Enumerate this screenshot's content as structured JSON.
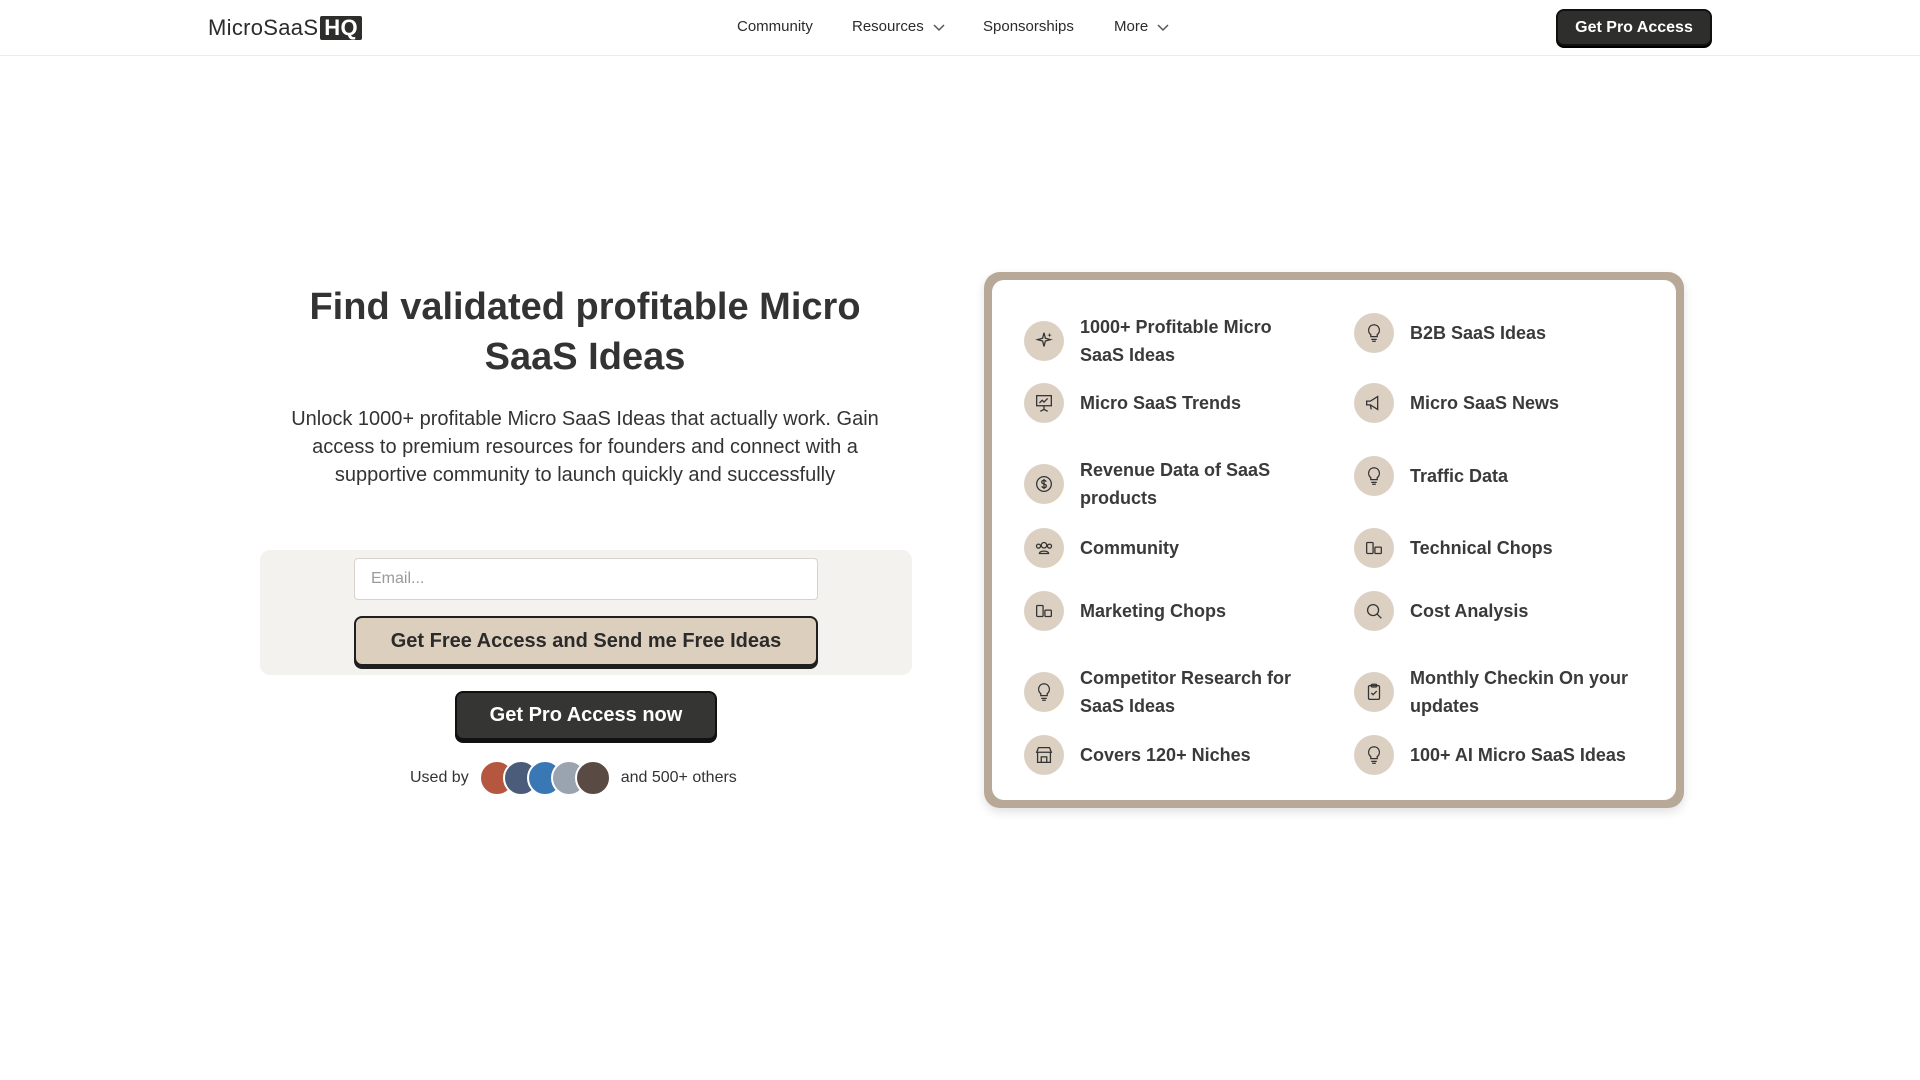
{
  "header": {
    "logo_text": "MicroSaaS",
    "logo_badge": "HQ",
    "nav": [
      {
        "label": "Community"
      },
      {
        "label": "Resources"
      },
      {
        "label": "Sponsorships"
      },
      {
        "label": "More"
      }
    ],
    "cta_label": "Get Pro Access"
  },
  "hero": {
    "title": "Find validated profitable Micro SaaS Ideas",
    "subtitle": "Unlock 1000+ profitable Micro SaaS Ideas that actually work. Gain access to premium resources for founders and connect with a supportive community to launch quickly and successfully",
    "email_placeholder": "Email...",
    "free_button": "Get Free Access and Send me Free Ideas",
    "pro_button": "Get Pro Access now",
    "used_by_prefix": "Used by",
    "used_by_suffix": "and 500+ others",
    "avatar_colors": [
      "#b5573f",
      "#4a5c7a",
      "#3a78b5",
      "#9aa4b0",
      "#5a4a44"
    ]
  },
  "features": [
    {
      "label": "1000+ Profitable Micro SaaS Ideas",
      "icon": "sparkles-icon"
    },
    {
      "label": "B2B SaaS Ideas",
      "icon": "lightbulb-icon"
    },
    {
      "label": "Micro SaaS Trends",
      "icon": "presentation-chart-icon"
    },
    {
      "label": "Micro SaaS News",
      "icon": "megaphone-icon"
    },
    {
      "label": "Revenue Data of SaaS products",
      "icon": "dollar-circle-icon"
    },
    {
      "label": "Traffic Data",
      "icon": "lightbulb-icon"
    },
    {
      "label": "Community",
      "icon": "users-icon"
    },
    {
      "label": "Technical Chops",
      "icon": "layout-icon"
    },
    {
      "label": "Marketing Chops",
      "icon": "layout-icon"
    },
    {
      "label": "Cost Analysis",
      "icon": "search-icon"
    },
    {
      "label": "Competitor Research for SaaS Ideas",
      "icon": "lightbulb-icon"
    },
    {
      "label": "Monthly Checkin On your updates",
      "icon": "clipboard-icon"
    },
    {
      "label": "Covers 120+ Niches",
      "icon": "store-icon"
    },
    {
      "label": "100+ AI Micro SaaS Ideas",
      "icon": "lightbulb-icon"
    }
  ],
  "colors": {
    "accent_dark": "#2e2e2c",
    "accent_beige": "#dccfbd",
    "card_border": "#b8a898",
    "icon_bg": "#dcd0c2"
  }
}
